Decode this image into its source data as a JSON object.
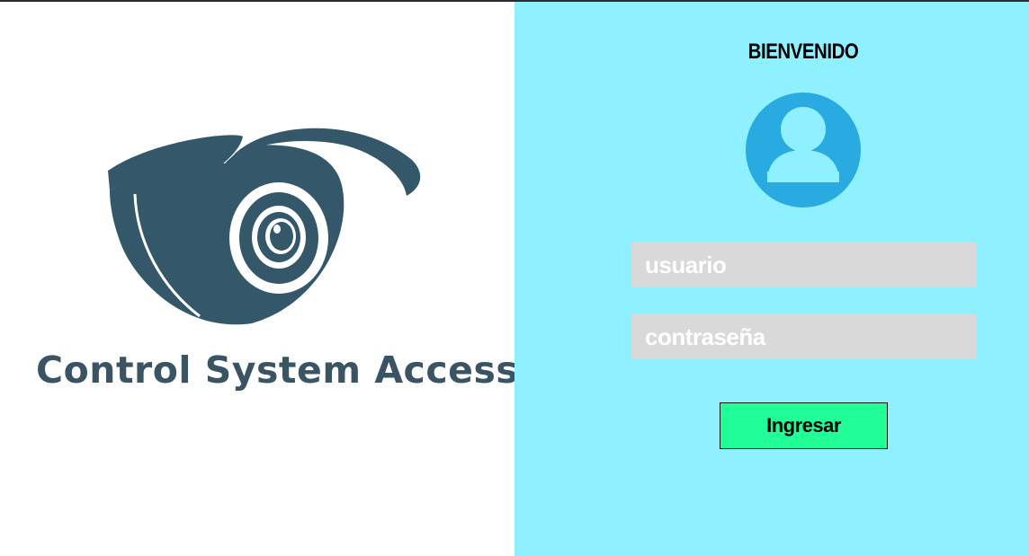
{
  "brand": {
    "logo_icon": "security-camera-icon",
    "name": "Control System Access",
    "color": "#3a5463"
  },
  "login": {
    "title": "BIENVENIDO",
    "avatar_icon": "user-avatar-icon",
    "avatar_color": "#29abe2",
    "username_placeholder": "usuario",
    "password_placeholder": "contraseña",
    "submit_label": "Ingresar",
    "panel_color": "#8ff1ff",
    "button_color": "#22fe97",
    "field_color": "#d9d9d9"
  }
}
